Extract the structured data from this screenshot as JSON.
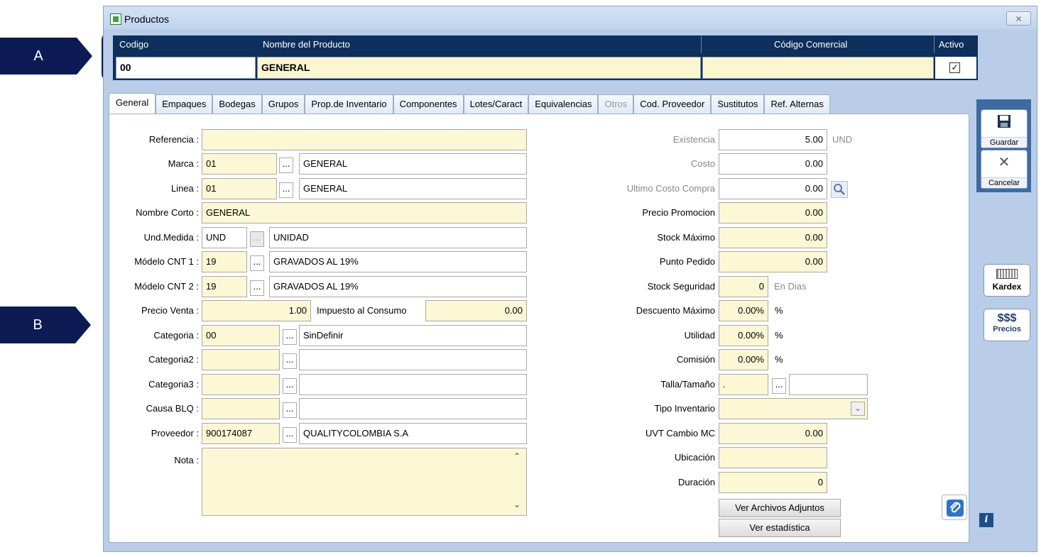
{
  "callouts": {
    "a": "A",
    "b": "B"
  },
  "window": {
    "title": "Productos",
    "close_label": "⨯"
  },
  "header": {
    "codigo_label": "Codigo",
    "nombre_label": "Nombre del Producto",
    "codigo_comercial_label": "Código Comercial",
    "activo_label": "Activo",
    "codigo_value": "00",
    "nombre_value": "GENERAL",
    "codigo_comercial_value": "",
    "activo_checked": "✓"
  },
  "tabs": [
    "General",
    "Empaques",
    "Bodegas",
    "Grupos",
    "Prop.de Inventario",
    "Componentes",
    "Lotes/Caract",
    "Equivalencias",
    "Otros",
    "Cod. Proveedor",
    "Sustitutos",
    "Ref. Alternas"
  ],
  "left": {
    "referencia_label": "Referencia :",
    "referencia_value": "",
    "marca_label": "Marca :",
    "marca_code": "01",
    "marca_name": "GENERAL",
    "linea_label": "Linea :",
    "linea_code": "01",
    "linea_name": "GENERAL",
    "nombre_corto_label": "Nombre Corto :",
    "nombre_corto_value": "GENERAL",
    "und_medida_label": "Und.Medida :",
    "und_medida_code": "UND",
    "und_medida_name": "UNIDAD",
    "modelo1_label": "Módelo CNT 1 :",
    "modelo1_code": "19",
    "modelo1_name": "GRAVADOS AL 19%",
    "modelo2_label": "Módelo CNT 2 :",
    "modelo2_code": "19",
    "modelo2_name": "GRAVADOS AL 19%",
    "precio_venta_label": "Precio Venta :",
    "precio_venta_value": "1.00",
    "impuesto_label": "Impuesto al Consumo",
    "impuesto_value": "0.00",
    "categoria_label": "Categoria :",
    "categoria_code": "00",
    "categoria_name": "SinDefinir",
    "categoria2_label": "Categoria2 :",
    "categoria2_code": "",
    "categoria2_name": "",
    "categoria3_label": "Categoria3 :",
    "categoria3_code": "",
    "categoria3_name": "",
    "causa_label": "Causa BLQ :",
    "causa_code": "",
    "causa_name": "",
    "proveedor_label": "Proveedor :",
    "proveedor_code": "900174087",
    "proveedor_name": "QUALITYCOLOMBIA S.A",
    "nota_label": "Nota :",
    "nota_value": ""
  },
  "right": {
    "existencia_label": "Existencia",
    "existencia_value": "5.00",
    "existencia_unit": "UND",
    "costo_label": "Costo",
    "costo_value": "0.00",
    "ultimo_costo_label": "Ultimo Costo Compra",
    "ultimo_costo_value": "0.00",
    "precio_promo_label": "Precio  Promocion",
    "precio_promo_value": "0.00",
    "stock_max_label": "Stock Máximo",
    "stock_max_value": "0.00",
    "punto_pedido_label": "Punto Pedido",
    "punto_pedido_value": "0.00",
    "stock_seg_label": "Stock Seguridad",
    "stock_seg_value": "0",
    "stock_seg_unit": "En Dias",
    "desc_max_label": "Descuento Máximo",
    "desc_max_value": "0.00%",
    "desc_max_unit": "%",
    "utilidad_label": "Utilidad",
    "utilidad_value": "0.00%",
    "utilidad_unit": "%",
    "comision_label": "Comisión",
    "comision_value": "0.00%",
    "comision_unit": "%",
    "talla_label": "Talla/Tamaño",
    "talla_code": ".",
    "talla_name": "",
    "tipo_inv_label": "Tipo Inventario",
    "tipo_inv_value": "",
    "uvt_label": "UVT Cambio MC",
    "uvt_value": "0.00",
    "ubicacion_label": "Ubicación",
    "ubicacion_value": "",
    "duracion_label": "Duración",
    "duracion_value": "0",
    "ver_adjuntos": "Ver Archivos Adjuntos",
    "ver_estadistica": "Ver estadística"
  },
  "toolbar": {
    "guardar": "Guardar",
    "cancelar": "Cancelar",
    "kardex": "Kardex",
    "precios_symbol": "$$$",
    "precios": "Precios",
    "info": "i",
    "dots": "..."
  },
  "icons": [
    "save-icon",
    "cancel-icon",
    "kardex-icon",
    "info-icon",
    "paperclip-icon",
    "search-icon",
    "chevron-down-icon"
  ]
}
